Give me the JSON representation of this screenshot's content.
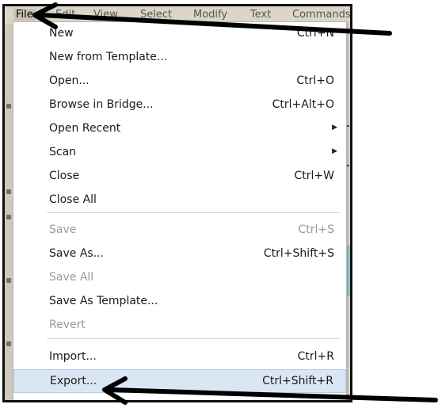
{
  "menubar": {
    "items": [
      "File",
      "Edit",
      "View",
      "Select",
      "Modify",
      "Text",
      "Commands"
    ]
  },
  "file_menu": {
    "items": [
      {
        "label": "New",
        "shortcut": "Ctrl+N",
        "enabled": true
      },
      {
        "label": "New from Template...",
        "shortcut": "",
        "enabled": true
      },
      {
        "label": "Open...",
        "shortcut": "Ctrl+O",
        "enabled": true
      },
      {
        "label": "Browse in Bridge...",
        "shortcut": "Ctrl+Alt+O",
        "enabled": true
      },
      {
        "label": "Open Recent",
        "shortcut": "",
        "submenu": true,
        "enabled": true
      },
      {
        "label": "Scan",
        "shortcut": "",
        "submenu": true,
        "enabled": true
      },
      {
        "label": "Close",
        "shortcut": "Ctrl+W",
        "enabled": true
      },
      {
        "label": "Close All",
        "shortcut": "",
        "enabled": true
      },
      {
        "label": "Save",
        "shortcut": "Ctrl+S",
        "enabled": false
      },
      {
        "label": "Save As...",
        "shortcut": "Ctrl+Shift+S",
        "enabled": true
      },
      {
        "label": "Save All",
        "shortcut": "",
        "enabled": false
      },
      {
        "label": "Save As Template...",
        "shortcut": "",
        "enabled": true
      },
      {
        "label": "Revert",
        "shortcut": "",
        "enabled": false
      },
      {
        "label": "Import...",
        "shortcut": "Ctrl+R",
        "enabled": true
      },
      {
        "label": "Export...",
        "shortcut": "Ctrl+Shift+R",
        "enabled": true,
        "highlighted": true
      }
    ]
  },
  "colors": {
    "highlight": "#dbe6f4",
    "disabled_text": "#9a9a9a",
    "annotation_arrow": "#000000"
  },
  "annotations": [
    {
      "name": "arrow-to-file-menu",
      "icon": "arrow-left-icon"
    },
    {
      "name": "arrow-to-export-item",
      "icon": "arrow-left-icon"
    }
  ]
}
